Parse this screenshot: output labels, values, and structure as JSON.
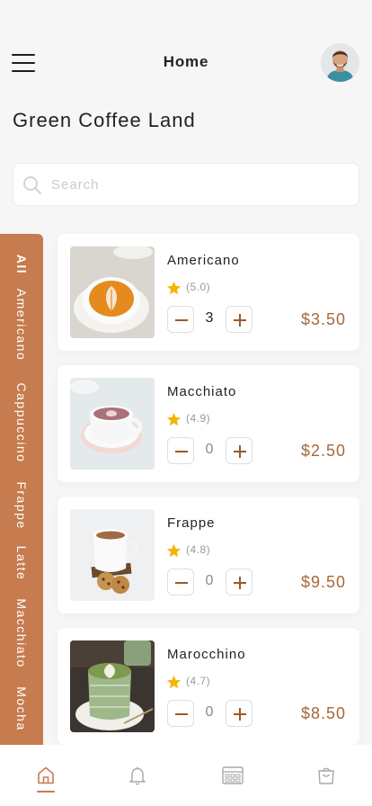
{
  "header": {
    "title": "Home",
    "avatar_icon": "user-avatar"
  },
  "store": {
    "title": "Green Coffee Land"
  },
  "search": {
    "placeholder": "Search",
    "value": ""
  },
  "categories": [
    "All",
    "Americano",
    "Cappuccino",
    "Frappe",
    "Latte",
    "Macchiato",
    "Mocha"
  ],
  "active_category": "All",
  "products": [
    {
      "name": "Americano",
      "rating": "(5.0)",
      "quantity": "3",
      "price": "$3.50"
    },
    {
      "name": "Macchiato",
      "rating": "(4.9)",
      "quantity": "0",
      "price": "$2.50"
    },
    {
      "name": "Frappe",
      "rating": "(4.8)",
      "quantity": "0",
      "price": "$9.50"
    },
    {
      "name": "Marocchino",
      "rating": "(4.7)",
      "quantity": "0",
      "price": "$8.50"
    }
  ],
  "bottom_nav": [
    {
      "icon": "home-icon",
      "active": true
    },
    {
      "icon": "bell-icon",
      "active": false
    },
    {
      "icon": "menu-board-icon",
      "active": false
    },
    {
      "icon": "shopping-bag-icon",
      "active": false
    }
  ],
  "colors": {
    "accent": "#c67c4e",
    "price": "#a5683a",
    "star": "#f5b400",
    "background": "#f6f6f6"
  }
}
